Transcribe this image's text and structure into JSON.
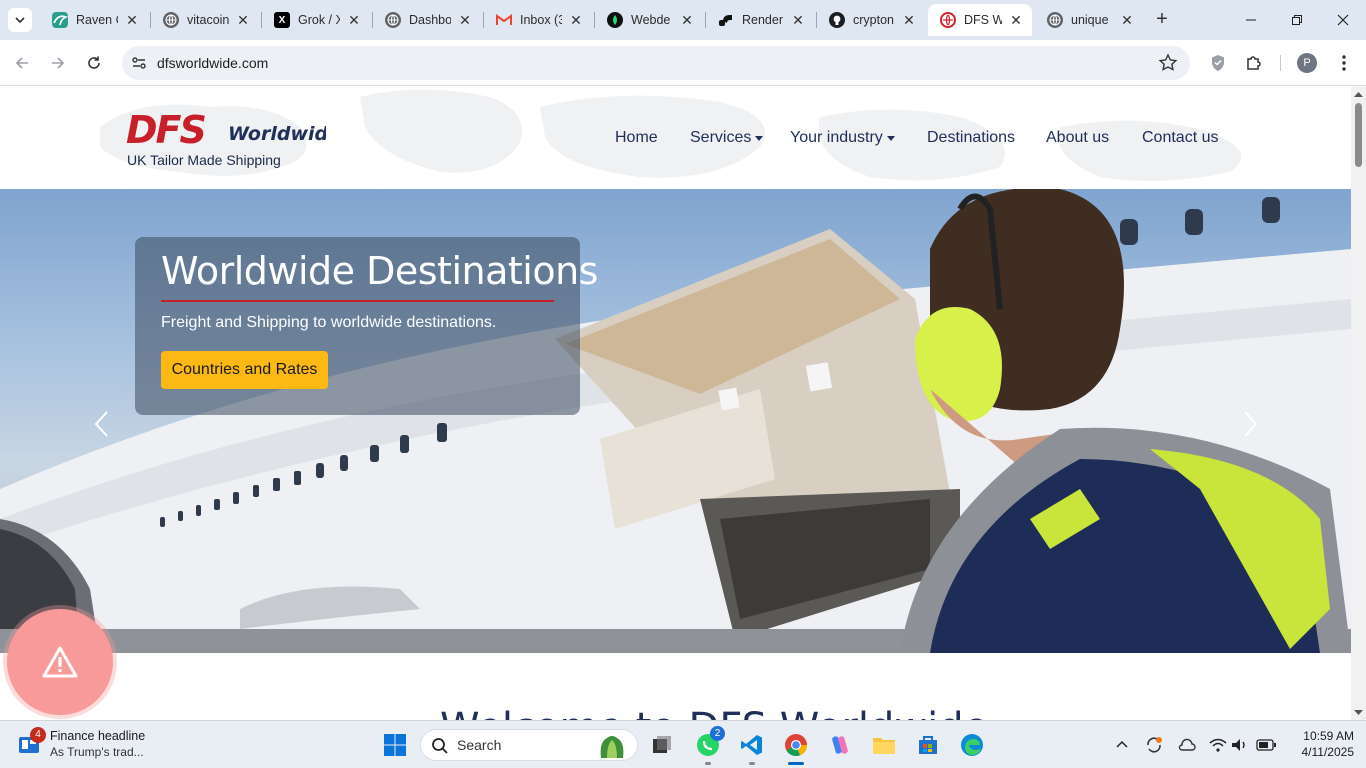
{
  "browser": {
    "tabs": [
      {
        "title": "Raven C",
        "icon": "raven-icon"
      },
      {
        "title": "vitacoin",
        "icon": "globe-icon"
      },
      {
        "title": "Grok / X",
        "icon": "x-icon"
      },
      {
        "title": "Dashbo",
        "icon": "globe-icon"
      },
      {
        "title": "Inbox (3",
        "icon": "gmail-icon"
      },
      {
        "title": "Webde",
        "icon": "webdev-icon"
      },
      {
        "title": "Render",
        "icon": "render-icon"
      },
      {
        "title": "crypton",
        "icon": "github-icon"
      },
      {
        "title": "DFS Wo",
        "icon": "dfs-globe-icon",
        "active": true
      },
      {
        "title": "unique",
        "icon": "globe-icon"
      }
    ],
    "url": "dfsworldwide.com",
    "profile_initial": "P"
  },
  "site": {
    "logo_text": "DFS",
    "logo_word": "Worldwide",
    "tagline": "UK Tailor Made Shipping",
    "nav": {
      "home": "Home",
      "services": "Services",
      "industry": "Your industry",
      "destinations": "Destinations",
      "about": "About us",
      "contact": "Contact us"
    },
    "hero": {
      "title": "Worldwide Destinations",
      "subtitle": "Freight and Shipping to worldwide destinations.",
      "cta": "Countries and Rates"
    },
    "welcome": "Welcome to DFS Worldwide"
  },
  "taskbar": {
    "news_title": "Finance headline",
    "news_sub": "As Trump's trad...",
    "news_badge": "4",
    "search_label": "Search",
    "whatsapp_badge": "2",
    "time": "10:59 AM",
    "date": "4/11/2025"
  },
  "colors": {
    "brand_red": "#c8202a",
    "brand_navy": "#20305a",
    "cta_yellow": "#fdb813",
    "alert_pink": "#f89a9a",
    "windows_blue": "#0067c0"
  }
}
